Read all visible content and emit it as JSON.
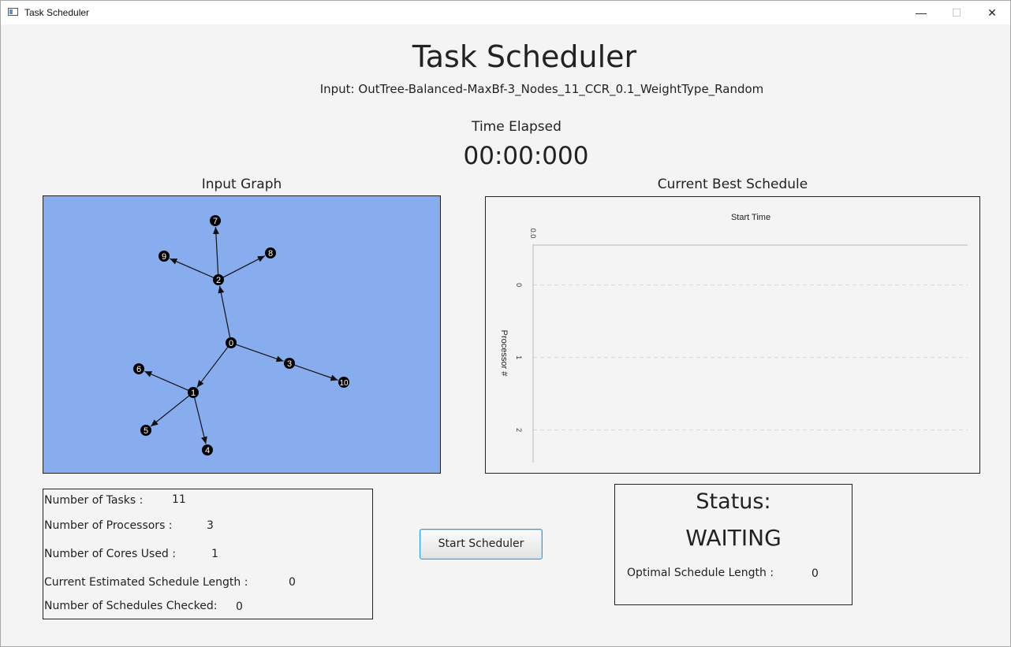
{
  "window": {
    "title": "Task Scheduler",
    "controls": {
      "minimize": "—",
      "maximize": "☐",
      "close": "✕"
    }
  },
  "header": {
    "title": "Task Scheduler",
    "input_label": "Input: OutTree-Balanced-MaxBf-3_Nodes_11_CCR_0.1_WeightType_Random",
    "elapsed_label": "Time Elapsed",
    "elapsed_value": "00:00:000"
  },
  "graph": {
    "title": "Input Graph",
    "background": "#87adef",
    "nodes": [
      "0",
      "1",
      "2",
      "3",
      "4",
      "5",
      "6",
      "7",
      "8",
      "9",
      "10"
    ],
    "edges": [
      [
        "0",
        "1"
      ],
      [
        "0",
        "2"
      ],
      [
        "0",
        "3"
      ],
      [
        "1",
        "4"
      ],
      [
        "1",
        "5"
      ],
      [
        "1",
        "6"
      ],
      [
        "2",
        "7"
      ],
      [
        "2",
        "8"
      ],
      [
        "2",
        "9"
      ],
      [
        "3",
        "10"
      ]
    ]
  },
  "schedule": {
    "title": "Current Best Schedule",
    "chart_data": {
      "type": "bar",
      "title": "",
      "xlabel": "Start Time",
      "ylabel": "Processor #",
      "x_ticks": [
        "0.0"
      ],
      "categories": [
        "0",
        "1",
        "2"
      ],
      "series": [],
      "grid": true
    }
  },
  "stats": {
    "tasks_label": "Number of Tasks :",
    "tasks_value": "11",
    "processors_label": "Number of Processors :",
    "processors_value": "3",
    "cores_label": "Number of Cores Used :",
    "cores_value": "1",
    "est_length_label": "Current Estimated Schedule Length :",
    "est_length_value": "0",
    "checked_label": "Number of Schedules Checked:",
    "checked_value": "0"
  },
  "controls": {
    "start_label": "Start Scheduler"
  },
  "status": {
    "label": "Status:",
    "value": "WAITING",
    "optimal_label": "Optimal Schedule Length :",
    "optimal_value": "0"
  }
}
